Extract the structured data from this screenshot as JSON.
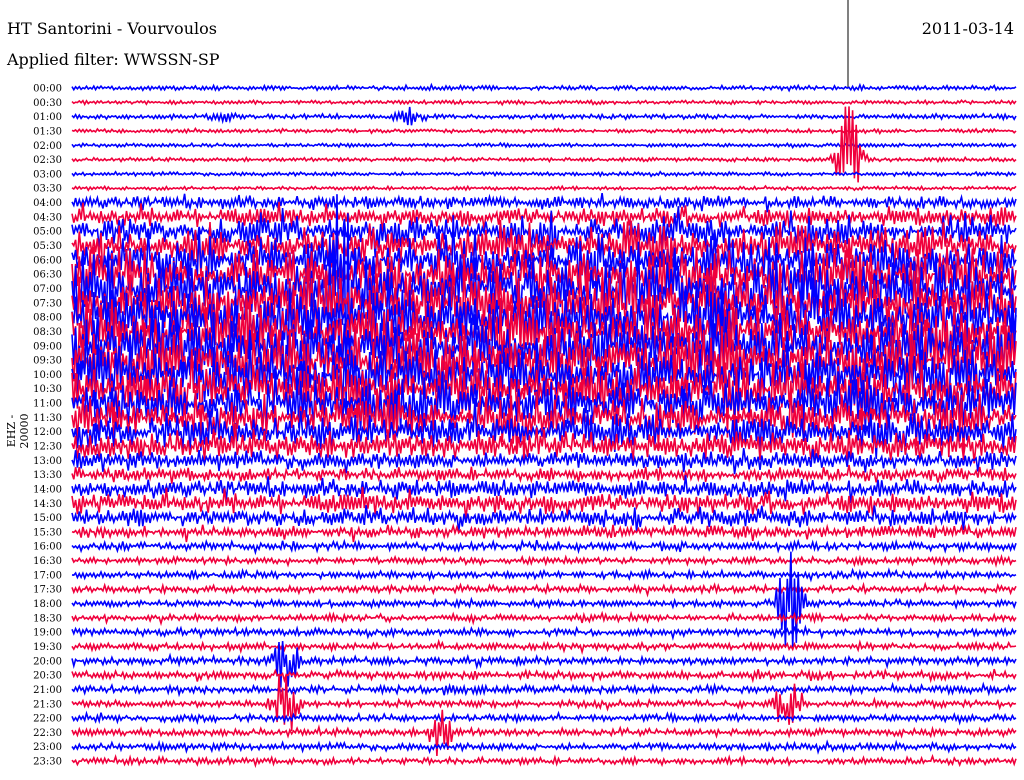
{
  "header": {
    "title": "HT Santorini - Vourvoulos",
    "filter": "Applied filter: WWSSN-SP",
    "date": "2011-03-14"
  },
  "chart_data": {
    "type": "line",
    "title": "HT Santorini - Vourvoulos",
    "ylabel": "EHZ - 20000",
    "row_minutes": 30,
    "colors": {
      "even": "#0000ff",
      "odd": "#f0003c",
      "marker": "#000000"
    },
    "row_labels": [
      "00:00",
      "00:30",
      "01:00",
      "01:30",
      "02:00",
      "02:30",
      "03:00",
      "03:30",
      "04:00",
      "04:30",
      "05:00",
      "05:30",
      "06:00",
      "06:30",
      "07:00",
      "07:30",
      "08:00",
      "08:30",
      "09:00",
      "09:30",
      "10:00",
      "10:30",
      "11:00",
      "11:30",
      "12:00",
      "12:30",
      "13:00",
      "13:30",
      "14:00",
      "14:30",
      "15:00",
      "15:30",
      "16:00",
      "16:30",
      "17:00",
      "17:30",
      "18:00",
      "18:30",
      "19:00",
      "19:30",
      "20:00",
      "20:30",
      "21:00",
      "21:30",
      "22:00",
      "22:30",
      "23:00",
      "23:30"
    ],
    "noise_level": [
      1.5,
      1,
      1.5,
      1,
      1,
      1,
      1,
      1,
      6,
      10,
      18,
      25,
      30,
      35,
      38,
      40,
      40,
      40,
      40,
      40,
      38,
      36,
      32,
      28,
      22,
      15,
      9,
      7,
      9,
      11,
      9,
      6,
      4,
      3,
      3,
      3,
      3,
      3,
      3,
      3,
      3.5,
      3.5,
      3.5,
      3,
      3,
      3,
      3,
      3
    ],
    "events": [
      {
        "row": 2,
        "minute": 10.7,
        "amp": 8
      },
      {
        "row": 2,
        "minute": 4.8,
        "amp": 4
      },
      {
        "row": 5,
        "minute": 24.7,
        "amp": 60
      },
      {
        "row": 14,
        "minute": 8.5,
        "amp": 120
      },
      {
        "row": 36,
        "minute": 22.8,
        "amp": 60
      },
      {
        "row": 40,
        "minute": 6.8,
        "amp": 30
      },
      {
        "row": 43,
        "minute": 6.8,
        "amp": 40
      },
      {
        "row": 43,
        "minute": 22.8,
        "amp": 45
      },
      {
        "row": 45,
        "minute": 11.7,
        "amp": 25
      }
    ]
  }
}
